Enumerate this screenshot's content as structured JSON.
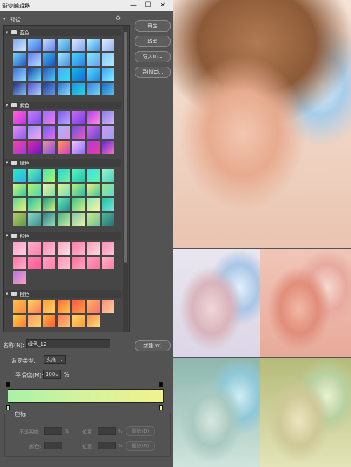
{
  "dialog": {
    "title": "渐变编辑器",
    "window_controls": [
      "—",
      "☐",
      "✕"
    ],
    "presets_label": "预设",
    "gear_icon": "gear-icon",
    "folders": [
      {
        "label": "蓝色",
        "rows": 4,
        "cols": 7,
        "count": 28,
        "colors": [
          [
            "#7aa7e8",
            "#d3e8ff"
          ],
          [
            "#8ad2ff",
            "#4a6be0"
          ],
          [
            "#c9e0ff",
            "#5f7fe8"
          ],
          [
            "#9be5f6",
            "#3c8fde"
          ],
          [
            "#dfe8ff",
            "#7da4f0"
          ],
          [
            "#b6f3ff",
            "#3e93e6"
          ],
          [
            "#e2eeff",
            "#8fb0ee"
          ],
          [
            "#6ad8f2",
            "#2b52c9"
          ],
          [
            "#5e7ff2",
            "#b9d9ff"
          ],
          [
            "#3fb7f0",
            "#1b4fb8"
          ],
          [
            "#9cefff",
            "#4b88e0"
          ],
          [
            "#49d4f7",
            "#2e7ce0"
          ],
          [
            "#7aeafe",
            "#6f9df0"
          ],
          [
            "#86c9ff",
            "#b3e8ff"
          ],
          [
            "#3e6fd8",
            "#8fd8ff"
          ],
          [
            "#1d3fa8",
            "#6fe3ff"
          ],
          [
            "#2e53c2",
            "#48c9ee"
          ],
          [
            "#57a6f5",
            "#25e4f0"
          ],
          [
            "#0fb9e8",
            "#1d6bd7"
          ],
          [
            "#5ad7ff",
            "#1c8be8"
          ],
          [
            "#3ca0ff",
            "#80f4ff"
          ],
          [
            "#2c2a88",
            "#7dc3f5"
          ],
          [
            "#5a4bd0",
            "#a3d8ff"
          ],
          [
            "#1a3f9b",
            "#6e9be6"
          ],
          [
            "#2a6ed0",
            "#8be0ff"
          ],
          [
            "#1c96d8",
            "#2cd2e8"
          ],
          [
            "#3a7de0",
            "#6fd8f0"
          ],
          [
            "#1e66c4",
            "#57c6f2"
          ]
        ]
      },
      {
        "label": "紫色",
        "rows": 3,
        "cols": 7,
        "count": 21,
        "colors": [
          [
            "#ff62d3",
            "#c233e8"
          ],
          [
            "#c77dff",
            "#7b4fe8"
          ],
          [
            "#9c6cf7",
            "#f07cf0"
          ],
          [
            "#7a5cf0",
            "#c0a3ff"
          ],
          [
            "#c36af7",
            "#7c3ce0"
          ],
          [
            "#b33ee8",
            "#ff8de2"
          ],
          [
            "#8f7be8",
            "#d1b7ff"
          ],
          [
            "#e58cf5",
            "#8d5cef"
          ],
          [
            "#9a8df5",
            "#f2a6f2"
          ],
          [
            "#6c64e8",
            "#e86af2"
          ],
          [
            "#a8b3f0",
            "#d892ee"
          ],
          [
            "#6a55d8",
            "#f056c8"
          ],
          [
            "#d366e2",
            "#6b44d6"
          ],
          [
            "#ce9af0",
            "#9c9ef2"
          ],
          [
            "#f2459c",
            "#a636e0"
          ],
          [
            "#e02ca6",
            "#6a1ac2"
          ],
          [
            "#f48fa0",
            "#7d4fe0"
          ],
          [
            "#ff9e4a",
            "#d43ad0"
          ],
          [
            "#f0c1ff",
            "#8a6df0"
          ],
          [
            "#b13ad8",
            "#e73d9e"
          ],
          [
            "#5a28c8",
            "#ff72c8"
          ]
        ]
      },
      {
        "label": "绿色",
        "rows": 4,
        "cols": 7,
        "count": 28,
        "colors": [
          [
            "#2de7c2",
            "#2bb5f0"
          ],
          [
            "#6cf2b7",
            "#22a9c9"
          ],
          [
            "#43e6b0",
            "#b6f56b"
          ],
          [
            "#25d6d6",
            "#78ee9c"
          ],
          [
            "#5cf0c0",
            "#1ec7a8"
          ],
          [
            "#3de0f0",
            "#5ef5a0"
          ],
          [
            "#9ef0d5",
            "#45d2b8"
          ],
          [
            "#d8f86f",
            "#2dc9a6"
          ],
          [
            "#bdf26a",
            "#47d7b5"
          ],
          [
            "#f2f0b0",
            "#7cde9a"
          ],
          [
            "#e6f58c",
            "#6ddcc0"
          ],
          [
            "#b9ef75",
            "#29b9a8"
          ],
          [
            "#f6f07d",
            "#34c8a0"
          ],
          [
            "#9de68d",
            "#5ed9d0"
          ],
          [
            "#5fd49a",
            "#f1f06e"
          ],
          [
            "#2bbfa0",
            "#b8f08a"
          ],
          [
            "#0fa38a",
            "#e2f07a"
          ],
          [
            "#67e8a8",
            "#1e8e9c"
          ],
          [
            "#3dc88a",
            "#d8ef8a"
          ],
          [
            "#8ce8b8",
            "#fff49a"
          ],
          [
            "#1fc49a",
            "#7ae3e6"
          ],
          [
            "#b8c868",
            "#5c9a48"
          ],
          [
            "#8ad8c8",
            "#3f8f8a"
          ],
          [
            "#2f7f8c",
            "#96e0b0"
          ],
          [
            "#4ab08a",
            "#c6ef9a"
          ],
          [
            "#89c8a8",
            "#e8f3a8"
          ],
          [
            "#cbe88a",
            "#6fc29a"
          ],
          [
            "#50b898",
            "#2b6e7a"
          ]
        ]
      },
      {
        "label": "粉色",
        "rows": 3,
        "cols": 7,
        "count": 15,
        "colors": [
          [
            "#ff9bc7",
            "#ffd1e3"
          ],
          [
            "#ffb0d0",
            "#ff7fa8"
          ],
          [
            "#ff86b3",
            "#ffc6da"
          ],
          [
            "#ffa3bf",
            "#ffe0ea"
          ],
          [
            "#ff7aa8",
            "#ffb8d0"
          ],
          [
            "#ff9bb8",
            "#ffd8e4"
          ],
          [
            "#ff8fb8",
            "#ffc3d6"
          ],
          [
            "#ff6fa3",
            "#ffb1cb"
          ],
          [
            "#ff82ae",
            "#ff5a92"
          ],
          [
            "#ffa1c3",
            "#ff7ea9"
          ],
          [
            "#ff94b7",
            "#ffc0d4"
          ],
          [
            "#ff6c9a",
            "#ffa8c3"
          ],
          [
            "#ff9cc0",
            "#ff6f9e"
          ],
          [
            "#ffb4cd",
            "#ff7aa3"
          ],
          [
            "#b07ad8",
            "#ff9ec2"
          ]
        ]
      },
      {
        "label": "橙色",
        "rows": 2,
        "cols": 7,
        "count": 13,
        "colors": [
          [
            "#ffbe4a",
            "#ff8a3c"
          ],
          [
            "#ffd75a",
            "#ff7a5a"
          ],
          [
            "#ff9f3a",
            "#ffcf6a"
          ],
          [
            "#ff6a3a",
            "#ffc84a"
          ],
          [
            "#ff5a40",
            "#ff9a4a"
          ],
          [
            "#ffb35a",
            "#ff6e6e"
          ],
          [
            "#ff8c7a",
            "#ffd0a0"
          ],
          [
            "#ffcf3a",
            "#ff7a3c"
          ],
          [
            "#ff9a6a",
            "#ffd36a"
          ],
          [
            "#ffb13a",
            "#ff5a3c"
          ],
          [
            "#ff7a5a",
            "#ffc46a"
          ],
          [
            "#ffd46a",
            "#ff9c3a"
          ],
          [
            "#ff8a4a",
            "#ffe07a"
          ]
        ]
      }
    ],
    "buttons": {
      "ok": "确定",
      "cancel": "取消",
      "import": "导入(I)...",
      "export": "导出(E)...",
      "new": "新建(W)"
    },
    "name_label": "名称(N):",
    "name_value": "绿色_12",
    "gradient_type_label": "渐变类型:",
    "gradient_type_value": "实底",
    "smoothness_label": "平滑度(M):",
    "smoothness_value": "100",
    "smoothness_unit": "%",
    "gradient_colors": [
      "#aaf1a8",
      "#d2f39e",
      "#f2f28e"
    ],
    "stops_legend": "色标",
    "opacity_label": "不透明度:",
    "color_label": "颜色:",
    "location_label": "位置:",
    "percent": "%",
    "delete_label": "删除(D)"
  },
  "photos": {
    "main_alt": "woman with clear hair curlers, warm toned",
    "grid_tones": [
      "cool pastel",
      "warm red",
      "teal green",
      "yellow green"
    ]
  }
}
